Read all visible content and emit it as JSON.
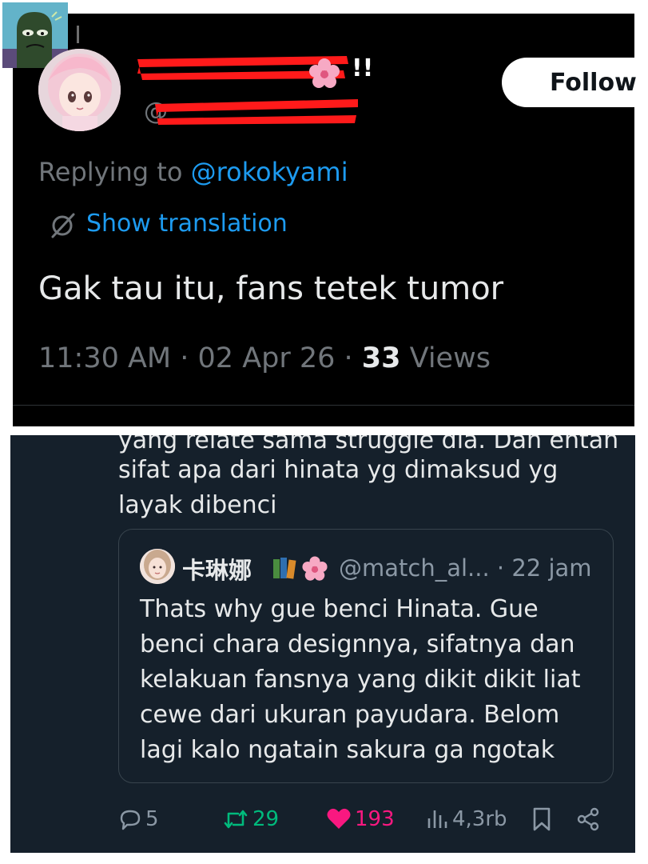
{
  "top_tweet": {
    "display_name_suffix": "!!",
    "handle_prefix": "@",
    "follow_label": "Follow",
    "replying_prefix": "Replying to ",
    "replying_handle": "@rokokyami",
    "show_translation": "Show translation",
    "text": "Gak tau itu, fans tetek tumor",
    "time": "11:30 AM",
    "date": "02 Apr 26",
    "sep": " · ",
    "views_count": "33",
    "views_label": " Views"
  },
  "reply": {
    "cut_line": "yang relate sama struggle dia. Dan entah",
    "lines": [
      "sifat apa dari hinata yg dimaksud yg",
      "layak dibenci"
    ],
    "quote": {
      "name": "卡琳娜",
      "handle": "@match_al...",
      "time": "· 22 jam",
      "lines": [
        "Thats why gue benci Hinata. Gue",
        "benci chara designnya, sifatnya dan",
        "kelakuan fansnya yang dikit dikit liat",
        "cewe dari ukuran payudara. Belom",
        "lagi kalo ngatain sakura ga ngotak"
      ]
    },
    "actions": {
      "replies": "5",
      "reposts": "29",
      "likes": "193",
      "views": "4,3rb"
    }
  },
  "colors": {
    "link": "#1d9bf0",
    "repost": "#00ba7c",
    "like": "#f91880",
    "redaction": "#ff1a1a",
    "dim_bg": "#15202b"
  },
  "icons": [
    "translate-icon",
    "reply-icon",
    "repost-icon",
    "heart-icon",
    "views-icon",
    "bookmark-icon",
    "share-icon"
  ]
}
